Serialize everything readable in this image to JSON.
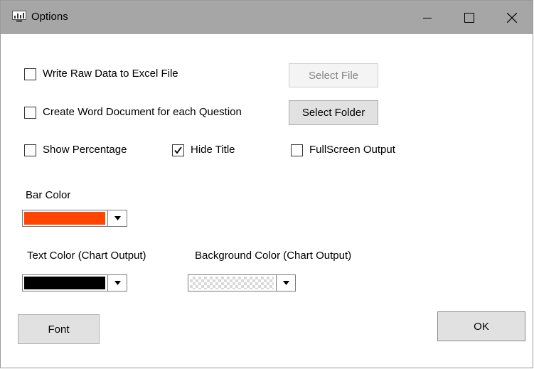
{
  "window": {
    "title": "Options",
    "icon": "chart-app-icon",
    "controls": [
      "minimize-icon",
      "maximize-icon",
      "close-icon"
    ]
  },
  "options": {
    "write_raw": {
      "label": "Write Raw Data to Excel File",
      "checked": false
    },
    "create_word": {
      "label": "Create Word Document for each Question",
      "checked": false
    },
    "show_percentage": {
      "label": "Show Percentage",
      "checked": false
    },
    "hide_title": {
      "label": "Hide Title",
      "checked": true
    },
    "fullscreen_output": {
      "label": "FullScreen Output",
      "checked": false
    }
  },
  "buttons": {
    "select_file": {
      "label": "Select File",
      "enabled": false
    },
    "select_folder": "Select Folder",
    "font": "Font",
    "ok": "OK"
  },
  "colors": {
    "bar_label": "Bar Color",
    "bar_value": "#ff4500",
    "text_label": "Text Color (Chart Output)",
    "text_value": "#000000",
    "background_label": "Background Color (Chart Output)",
    "background_value": "transparent"
  }
}
